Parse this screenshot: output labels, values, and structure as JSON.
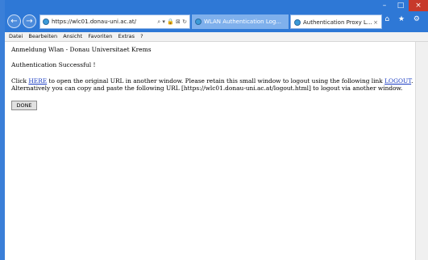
{
  "browser": {
    "address": "https://wlc01.donau-uni.ac.at/",
    "address_icons": "⌕ ▾ 🔒 ⊠ ↻",
    "tabs": [
      {
        "label": "WLAN Authentication Log..."
      },
      {
        "label": "Authentication Proxy L...",
        "close": "×"
      }
    ],
    "caption": {
      "minimize": "–",
      "maximize": "□",
      "close": "×"
    },
    "right_icons": "⌂ ★ ⚙"
  },
  "menu": [
    "Datei",
    "Bearbeiten",
    "Ansicht",
    "Favoriten",
    "Extras",
    "?"
  ],
  "page": {
    "heading": "Anmeldung Wlan - Donau Universitaet Krems",
    "success": "Authentication Successful !",
    "para_1": "Click ",
    "link_here": "HERE",
    "para_2": " to open the original URL in another window. Please retain this small window to logout using the following link ",
    "link_logout": "LOGOUT",
    "para_3": ".",
    "para_4": "Alternatively you can copy and paste the following URL [https://wlc01.donau-uni.ac.at/logout.html] to logout via another window.",
    "done": "DONE"
  },
  "colors": {
    "frame": "#2e78d6",
    "link": "#1a3cc2",
    "close": "#c7392b"
  }
}
